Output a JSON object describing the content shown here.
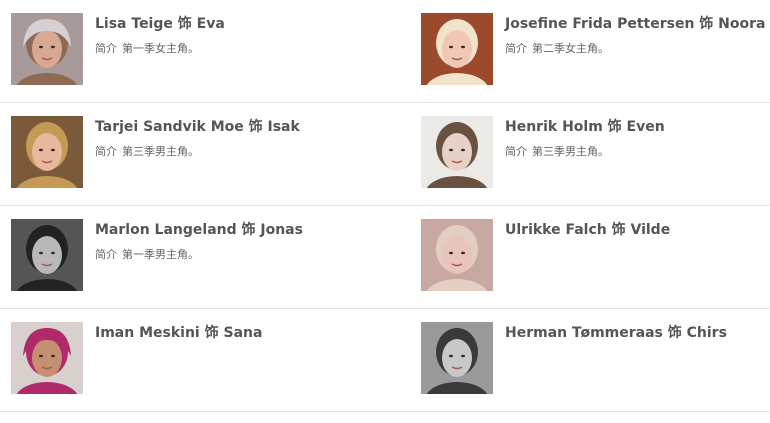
{
  "cast": [
    {
      "actor": "Lisa Teige",
      "sep": "饰",
      "role": "Eva",
      "intro_label": "简介",
      "intro_text": "第一季女主角。",
      "photo": {
        "icon": "portrait-photo",
        "skin": "#d9a894",
        "hair": "#8c6a54",
        "hat": "#d8cfd2",
        "bg": "#a89a98"
      }
    },
    {
      "actor": "Josefine Frida Pettersen",
      "sep": "饰",
      "role": "Noora",
      "intro_label": "简介",
      "intro_text": "第二季女主角。",
      "photo": {
        "icon": "portrait-photo",
        "skin": "#efc7b3",
        "hair": "#f0e4cc",
        "hat": "",
        "bg": "#9b4a2c"
      }
    },
    {
      "actor": "Tarjei Sandvik Moe",
      "sep": "饰",
      "role": "Isak",
      "intro_label": "简介",
      "intro_text": "第三季男主角。",
      "photo": {
        "icon": "portrait-photo",
        "skin": "#e7b89d",
        "hair": "#c59a55",
        "hat": "",
        "bg": "#7a5a3a"
      }
    },
    {
      "actor": "Henrik Holm",
      "sep": "饰",
      "role": "Even",
      "intro_label": "简介",
      "intro_text": "第三季男主角。",
      "photo": {
        "icon": "portrait-photo",
        "skin": "#e6d2c6",
        "hair": "#6a5242",
        "hat": "",
        "bg": "#eceae6"
      }
    },
    {
      "actor": "Marlon Langeland",
      "sep": "饰",
      "role": "Jonas",
      "intro_label": "简介",
      "intro_text": "第一季男主角。",
      "photo": {
        "icon": "portrait-photo",
        "skin": "#b8b8b8",
        "hair": "#222222",
        "hat": "",
        "bg": "#555555"
      }
    },
    {
      "actor": "Ulrikke Falch",
      "sep": "饰",
      "role": "Vilde",
      "intro_label": "",
      "intro_text": "",
      "photo": {
        "icon": "portrait-photo",
        "skin": "#e8c4bc",
        "hair": "#e2cfc2",
        "hat": "",
        "bg": "#c9a8a4"
      }
    },
    {
      "actor": "Iman Meskini",
      "sep": "饰",
      "role": "Sana",
      "intro_label": "",
      "intro_text": "",
      "photo": {
        "icon": "portrait-photo",
        "skin": "#c58f72",
        "hair": "#b02a6a",
        "hat": "#b02a6a",
        "bg": "#d7d0cc"
      }
    },
    {
      "actor": "Herman Tømmeraas",
      "sep": "饰",
      "role": "Chirs",
      "intro_label": "",
      "intro_text": "",
      "photo": {
        "icon": "portrait-photo",
        "skin": "#c8c8c8",
        "hair": "#3a3a3a",
        "hat": "",
        "bg": "#9a9a9a"
      }
    }
  ]
}
